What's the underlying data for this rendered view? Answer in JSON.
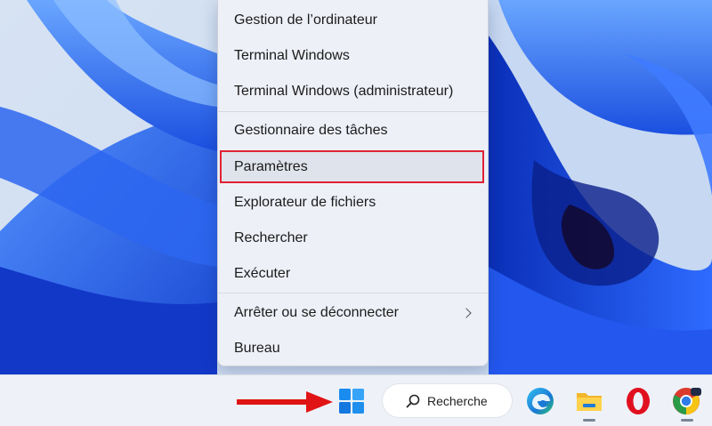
{
  "context_menu": {
    "items": [
      {
        "label": "Gestion de l’ordinateur"
      },
      {
        "label": "Terminal Windows"
      },
      {
        "label": "Terminal Windows (administrateur)"
      },
      {
        "label": "Gestionnaire des tâches"
      },
      {
        "label": "Paramètres",
        "highlighted": true
      },
      {
        "label": "Explorateur de fichiers"
      },
      {
        "label": "Rechercher"
      },
      {
        "label": "Exécuter"
      },
      {
        "label": "Arrêter ou se déconnecter",
        "has_submenu": true
      },
      {
        "label": "Bureau"
      }
    ]
  },
  "taskbar": {
    "search_label": "Recherche",
    "icons": [
      "windows-start-icon",
      "search-icon",
      "edge-icon",
      "file-explorer-icon",
      "opera-icon",
      "chrome-icon"
    ]
  },
  "colors": {
    "highlight_border": "#e02232",
    "arrow": "#e01414",
    "start_blue": "#1a8cf0",
    "wallpaper_blue": "#1f5ee6"
  }
}
